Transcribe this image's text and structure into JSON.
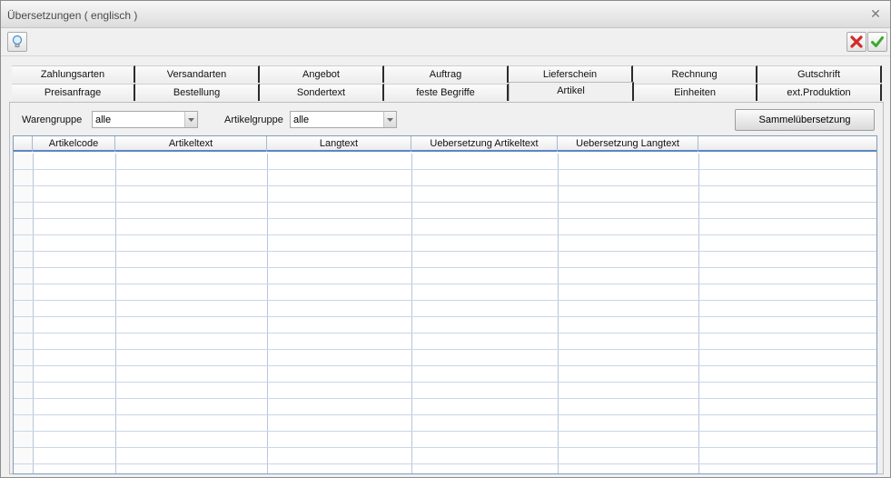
{
  "window": {
    "title": "Übersetzungen ( englisch )"
  },
  "tabs": {
    "row1": [
      "Zahlungsarten",
      "Versandarten",
      "Angebot",
      "Auftrag",
      "Lieferschein",
      "Rechnung",
      "Gutschrift"
    ],
    "row2": [
      "Preisanfrage",
      "Bestellung",
      "Sondertext",
      "feste Begriffe",
      "Artikel",
      "Einheiten",
      "ext.Produktion"
    ],
    "active": "Artikel"
  },
  "filters": {
    "warengruppe_label": "Warengruppe",
    "warengruppe_value": "alle",
    "artikelgruppe_label": "Artikelgruppe",
    "artikelgruppe_value": "alle"
  },
  "sammel_button": "Sammelübersetzung",
  "table": {
    "columns": [
      "Artikelcode",
      "Artikeltext",
      "Langtext",
      "Uebersetzung Artikeltext",
      "Uebersetzung Langtext"
    ],
    "rows": []
  },
  "icons": {
    "toolbar_left": "lightbulb-icon",
    "cancel": "red-x-icon",
    "confirm": "green-check-icon"
  },
  "colors": {
    "grid_header_border": "#5b86c5",
    "grid_line": "#c9d6e6",
    "cancel": "#d42a2a",
    "confirm": "#3aa82c"
  }
}
